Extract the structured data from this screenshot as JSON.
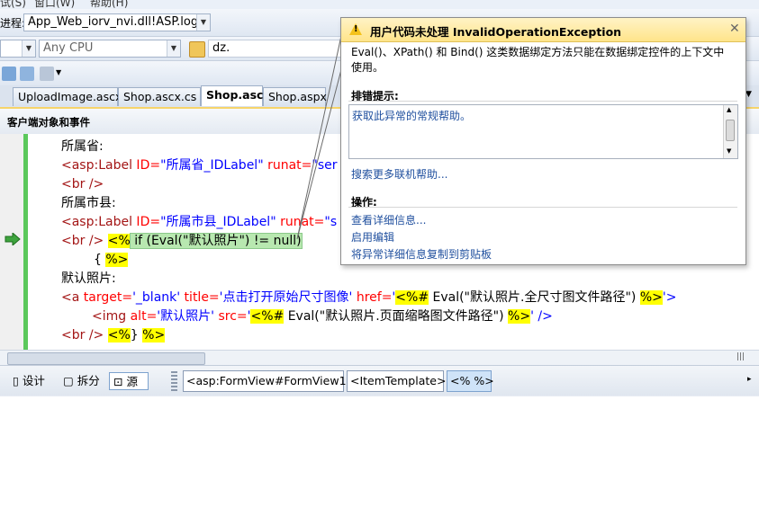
{
  "menu": {
    "item1": "试(S)",
    "item2": "窗口(W)",
    "item3": "帮助(H)"
  },
  "toolbar": {
    "process_label": "进程:",
    "process_value": "App_Web_iorv_nvi.dll!ASP.logo",
    "platform_value": "Any CPU",
    "find_value": "dz."
  },
  "tabs": [
    {
      "label": "UploadImage.ascx"
    },
    {
      "label": "Shop.ascx.cs"
    },
    {
      "label": "Shop.ascx"
    },
    {
      "label": "Shop.aspx"
    }
  ],
  "object_bar": {
    "label": "客户端对象和事件"
  },
  "code": {
    "l1": "所属省:",
    "l2": {
      "tag": "<asp:Label",
      "attr1": " ID=",
      "val1": "\"所属省_IDLabel\"",
      "attr2": " runat=",
      "val2": "\"ser"
    },
    "l3": "<br />",
    "l4": "所属市县:",
    "l5": {
      "tag": "<asp:Label",
      "attr1": " ID=",
      "val1": "\"所属市县_IDLabel\"",
      "attr2": " runat=",
      "val2": "\"s"
    },
    "l6": {
      "br": "<br /> ",
      "open": "<%",
      "code": " if (Eval(\"默认照片\") != null)"
    },
    "l7": {
      "brace": "{ ",
      "close": "%>"
    },
    "l8": "默认照片:",
    "l9": {
      "tag": "<a",
      "a1": " target=",
      "v1": "'_blank'",
      "a2": " title=",
      "v2": "'点击打开原始尺寸图像'",
      "a3": " href=",
      "v3": "'",
      "open": "<%#",
      "expr": " Eval(\"默认照片.全尺寸图文件路径\") ",
      "close": "%>",
      "end": "'>"
    },
    "l10": {
      "tag": "<img",
      "a1": " alt=",
      "v1": "'默认照片'",
      "a2": " src=",
      "v2": "'",
      "open": "<%#",
      "expr": " Eval(\"默认照片.页面缩略图文件路径\") ",
      "close": "%>",
      "end": "' />"
    },
    "l11": {
      "br": "<br /> ",
      "open": "<%",
      "code": "} ",
      "close": "%>"
    }
  },
  "bottom": {
    "design": "设计",
    "split": "拆分",
    "source": "源",
    "crumbs": [
      "<asp:FormView#FormView1>",
      "<ItemTemplate>",
      "<% %>"
    ]
  },
  "exception": {
    "title": "用户代码未处理 InvalidOperationException",
    "message": "Eval()、XPath() 和 Bind() 这类数据绑定方法只能在数据绑定控件的上下文中使用。",
    "tips_header": "排错提示:",
    "tip_link": "获取此异常的常规帮助。",
    "more_help": "搜索更多联机帮助...",
    "actions_header": "操作:",
    "actions": [
      "查看详细信息...",
      "启用编辑",
      "将异常详细信息复制到剪贴板"
    ]
  },
  "colors": {
    "tag": "#a31515",
    "attr": "#ff0000",
    "value": "#0000ff",
    "block_delim": "#ffff00",
    "statement_highlight": "#b8e8b0",
    "popup_header": "#ffe48a",
    "link": "#1f4f9e",
    "change_bar": "#5bc85b"
  },
  "icons": [
    "warning-icon",
    "close-icon",
    "current-statement-arrow-icon",
    "folder-open-icon",
    "design-view-icon",
    "split-view-icon",
    "source-view-icon"
  ]
}
